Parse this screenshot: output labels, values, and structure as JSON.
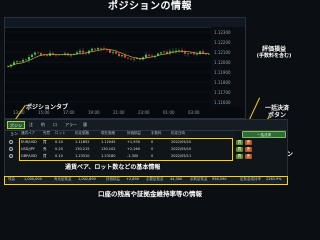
{
  "page": {
    "title": "ポジションの情報"
  },
  "annotations": {
    "realized_pnl": "評価損益",
    "realized_pnl_sub": "(手数料を含む)",
    "position_tab": "ポジションタブ",
    "bulk_settle": "一括決済",
    "bulk_settle_sub": "ボタン",
    "settle_button": "決済ボタン",
    "basic_info": "通貨ペア、ロット数などの基本情報",
    "account_info": "口座の残高や証拠金維持率等の情報"
  },
  "chart": {
    "price_labels": [
      "1.12300",
      "1.12200",
      "1.12100",
      "1.12000",
      "1.11900",
      "1.11800",
      "1.11700",
      "1.11600"
    ],
    "time_labels": [
      "13:00",
      "15:00",
      "17:00",
      "19:00",
      "21:00",
      "23:00",
      "01:00",
      "03:00"
    ],
    "colors": {
      "up": "#3fbf5f",
      "down": "#e04a3a",
      "ma": "#d9c43c",
      "grid": "#17212a"
    }
  },
  "panel": {
    "tabs": [
      "ポジション",
      "注文",
      "約定",
      "口座",
      "アラート",
      "履歴"
    ],
    "active_tab": "ポジション",
    "columns": [
      "通貨ペア",
      "売買",
      "ロット",
      "約定価格",
      "現在価格",
      "評価損益",
      "手数料",
      "約定日時"
    ],
    "rows": [
      {
        "pair": "EUR/USD",
        "side": "買",
        "lots": "0.10",
        "open": "1.11852",
        "current": "1.12045",
        "pnl": "+1,930",
        "fee": "0",
        "time": "2022/05/10"
      },
      {
        "pair": "USD/JPY",
        "side": "売",
        "lots": "0.20",
        "open": "130.215",
        "current": "130.102",
        "pnl": "+2,260",
        "fee": "0",
        "time": "2022/05/10"
      },
      {
        "pair": "GBP/USD",
        "side": "買",
        "lots": "0.10",
        "open": "1.23310",
        "current": "1.23180",
        "pnl": "-1,300",
        "fee": "0",
        "time": "2022/05/11"
      }
    ],
    "bulk_button": "一括決済",
    "buy_label": "買",
    "sell_label": "売"
  },
  "footer": {
    "labels": [
      "残高",
      "有効証拠金",
      "評価損益",
      "必要証拠金",
      "余剰証拠金",
      "証拠金維持率"
    ],
    "values": [
      "1,000,000",
      "1,002,890",
      "+2,890",
      "44,300",
      "958,590",
      "2263.9%"
    ]
  }
}
